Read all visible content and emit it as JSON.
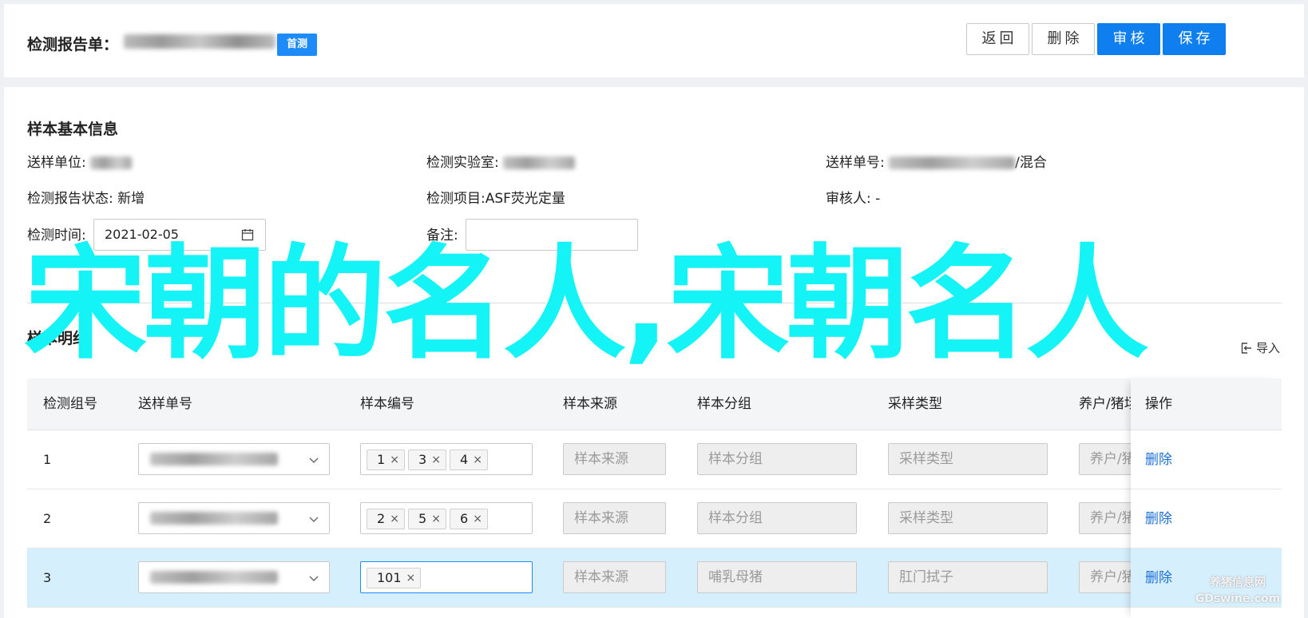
{
  "header": {
    "title": "检测报告单：",
    "badge": "首测",
    "buttons": {
      "back": "返回",
      "delete": "删除",
      "review": "审核",
      "save": "保存"
    }
  },
  "basic_info": {
    "title": "样本基本信息",
    "unit_label": "送样单位:",
    "lab_label": "检测实验室:",
    "order_label": "送样单号:",
    "order_suffix": "/混合",
    "status_label": "检测报告状态:",
    "status_value": "新增",
    "item_label": "检测项目:",
    "item_value": "ASF荧光定量",
    "reviewer_label": "审核人:",
    "reviewer_value": "-",
    "time_label": "检测时间:",
    "time_value": "2021-02-05",
    "remark_label": "备注:",
    "remark_value": ""
  },
  "sample_section": {
    "title": "样本明细",
    "import_label": "导入"
  },
  "table": {
    "columns": [
      "检测组号",
      "送样单号",
      "样本编号",
      "样本来源",
      "样本分组",
      "采样类型",
      "养户/猪场",
      "操作"
    ],
    "rows": [
      {
        "group": "1",
        "tags": [
          "1",
          "3",
          "4"
        ],
        "source": "样本来源",
        "sgroup": "样本分组",
        "stype": "采样类型",
        "farm": "养户/猪场",
        "op": "删除"
      },
      {
        "group": "2",
        "tags": [
          "2",
          "5",
          "6"
        ],
        "source": "样本来源",
        "sgroup": "样本分组",
        "stype": "采样类型",
        "farm": "养户/猪场",
        "op": "删除"
      },
      {
        "group": "3",
        "tags": [
          "101"
        ],
        "source": "样本来源",
        "sgroup": "哺乳母猪",
        "stype": "肛门拭子",
        "farm": "养户/猪场",
        "op": "删除"
      }
    ],
    "tag_close": "×"
  },
  "overlay_text": "宋朝的名人,宋朝名人",
  "watermark": {
    "line1": "养猪信息网",
    "line2": "GDswine.com"
  },
  "colors": {
    "primary": "#0f7ff0",
    "badge": "#1d8cf8",
    "overlay": "#14f3f6",
    "selected_row": "#d6effd",
    "link": "#1d6fd6"
  }
}
